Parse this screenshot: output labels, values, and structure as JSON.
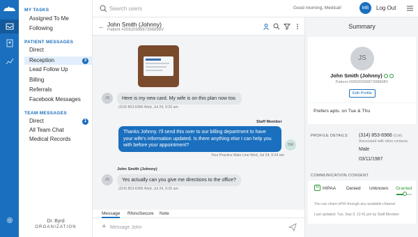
{
  "nav": {
    "my_tasks_title": "MY TASKS",
    "my_tasks": [
      "Assigned To Me",
      "Following"
    ],
    "patient_messages_title": "PATIENT MESSAGES",
    "patient_messages": [
      {
        "label": "Direct",
        "badge": ""
      },
      {
        "label": "Reception",
        "badge": "3",
        "active": true
      },
      {
        "label": "Lead Follow Up",
        "badge": ""
      },
      {
        "label": "Billing",
        "badge": ""
      },
      {
        "label": "Referrals",
        "badge": ""
      },
      {
        "label": "Facebook Messages",
        "badge": ""
      }
    ],
    "team_messages_title": "TEAM MESSAGES",
    "team_messages": [
      {
        "label": "Direct",
        "badge": "1"
      },
      {
        "label": "All Team Chat",
        "badge": ""
      },
      {
        "label": "Medical Records",
        "badge": ""
      }
    ],
    "org_name": "Dr. Byrd",
    "org_label": "ORGANIZATION"
  },
  "topbar": {
    "search_placeholder": "Search users",
    "greeting": "Good morning, Medical!",
    "user_initials": "MB",
    "logout_label": "Log Out"
  },
  "chat": {
    "patient_name": "John Smith (Johnny)",
    "patient_id": "Patient #0092099987398898V",
    "messages": {
      "m1_avatar": "JS",
      "m1_text": "Here is my new card. My wife is on this plan now too.",
      "m1_meta": "(314) 853-6966  Wed, Jul 24, 9:20 am",
      "m2_sender": "Staff Member",
      "m2_avatar": "SM",
      "m2_text": "Thanks Johnny. I'll send this over to our billing department to have your wife's information updated. Is there anything else I can help you with before your appointment?",
      "m2_meta": "Your Practice Main Line  Wed, Jul 24, 9:24 am",
      "m3_sender": "John Smith (Johnny)",
      "m3_avatar": "JS",
      "m3_text": "Yes actually can you give me directions to the office?",
      "m3_meta": "(314) 853-6966  Wed, Jul 24, 9:25 am"
    },
    "tabs": [
      "Message",
      "RhinoSecure",
      "Note"
    ],
    "composer_placeholder": "Message John"
  },
  "summary": {
    "title": "Summary",
    "initials": "JS",
    "name": "John Smith (Johnny)",
    "patient_id": "Patient #0092099987398898V",
    "edit_label": "Edit Profile",
    "preference": "Prefers apts. on Tue & Thu",
    "profile_details_label": "PROFILE DETAILS",
    "phone": "(314) 853-6966",
    "phone_type": "(Cell)",
    "phone_hint": "Associated with other contacts",
    "gender": "Male",
    "dob": "03/11/1987",
    "consent_label": "COMMUNICATION CONSENT",
    "hipaa_label": "HIPAA",
    "consent_options": [
      "Denied",
      "Unknown",
      "Granted"
    ],
    "consent_level": "Granted",
    "consent_note": "You can share ePHI through any available channel.",
    "last_updated": "Last updated: Tue, Sep 3, 12:41 pm by Staff Member"
  },
  "colors": {
    "brand": "#1a6fbe",
    "granted": "#2e9a3b"
  }
}
